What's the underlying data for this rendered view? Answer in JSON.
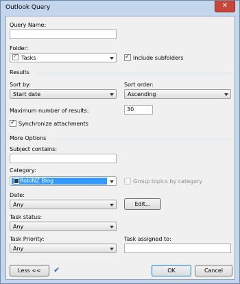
{
  "window": {
    "title": "Outlook Query",
    "close_glyph": "✕"
  },
  "query_name": {
    "label": "Query Name:",
    "value": ""
  },
  "folder": {
    "label": "Folder:",
    "value": "Tasks",
    "include_subfolders_label": "Include subfolders",
    "include_subfolders_checked": true
  },
  "results": {
    "section_label": "Results",
    "sort_by_label": "Sort by:",
    "sort_by_value": "Start date",
    "sort_order_label": "Sort order:",
    "sort_order_value": "Ascending",
    "max_results_label": "Maximum number of results:",
    "max_results_value": "30",
    "sync_attachments_label": "Synchronize attachments",
    "sync_attachments_checked": true
  },
  "more_options": {
    "section_label": "More Options",
    "subject_label": "Subject contains:",
    "subject_value": "",
    "category_label": "Category:",
    "category_value": "RobiNZ Blog",
    "group_topics_label": "Group topics by category",
    "group_topics_checked": false,
    "date_label": "Date:",
    "date_value": "Any",
    "edit_button": "Edit...",
    "task_status_label": "Task status:",
    "task_status_value": "Any",
    "task_priority_label": "Task Priority:",
    "task_priority_value": "Any",
    "task_assigned_label": "Task assigned to:",
    "task_assigned_value": ""
  },
  "footer": {
    "less_button": "Less <<",
    "ok_button": "OK",
    "cancel_button": "Cancel"
  },
  "icons": {
    "folder_icon": "task-icon",
    "category_icon": "category-swatch-icon",
    "validate_icon": "checkmark-icon"
  },
  "colors": {
    "titlebar": "#c3d6ec",
    "close": "#c7463a",
    "selection": "#3399ff",
    "category_swatch": "#1b3f72"
  }
}
